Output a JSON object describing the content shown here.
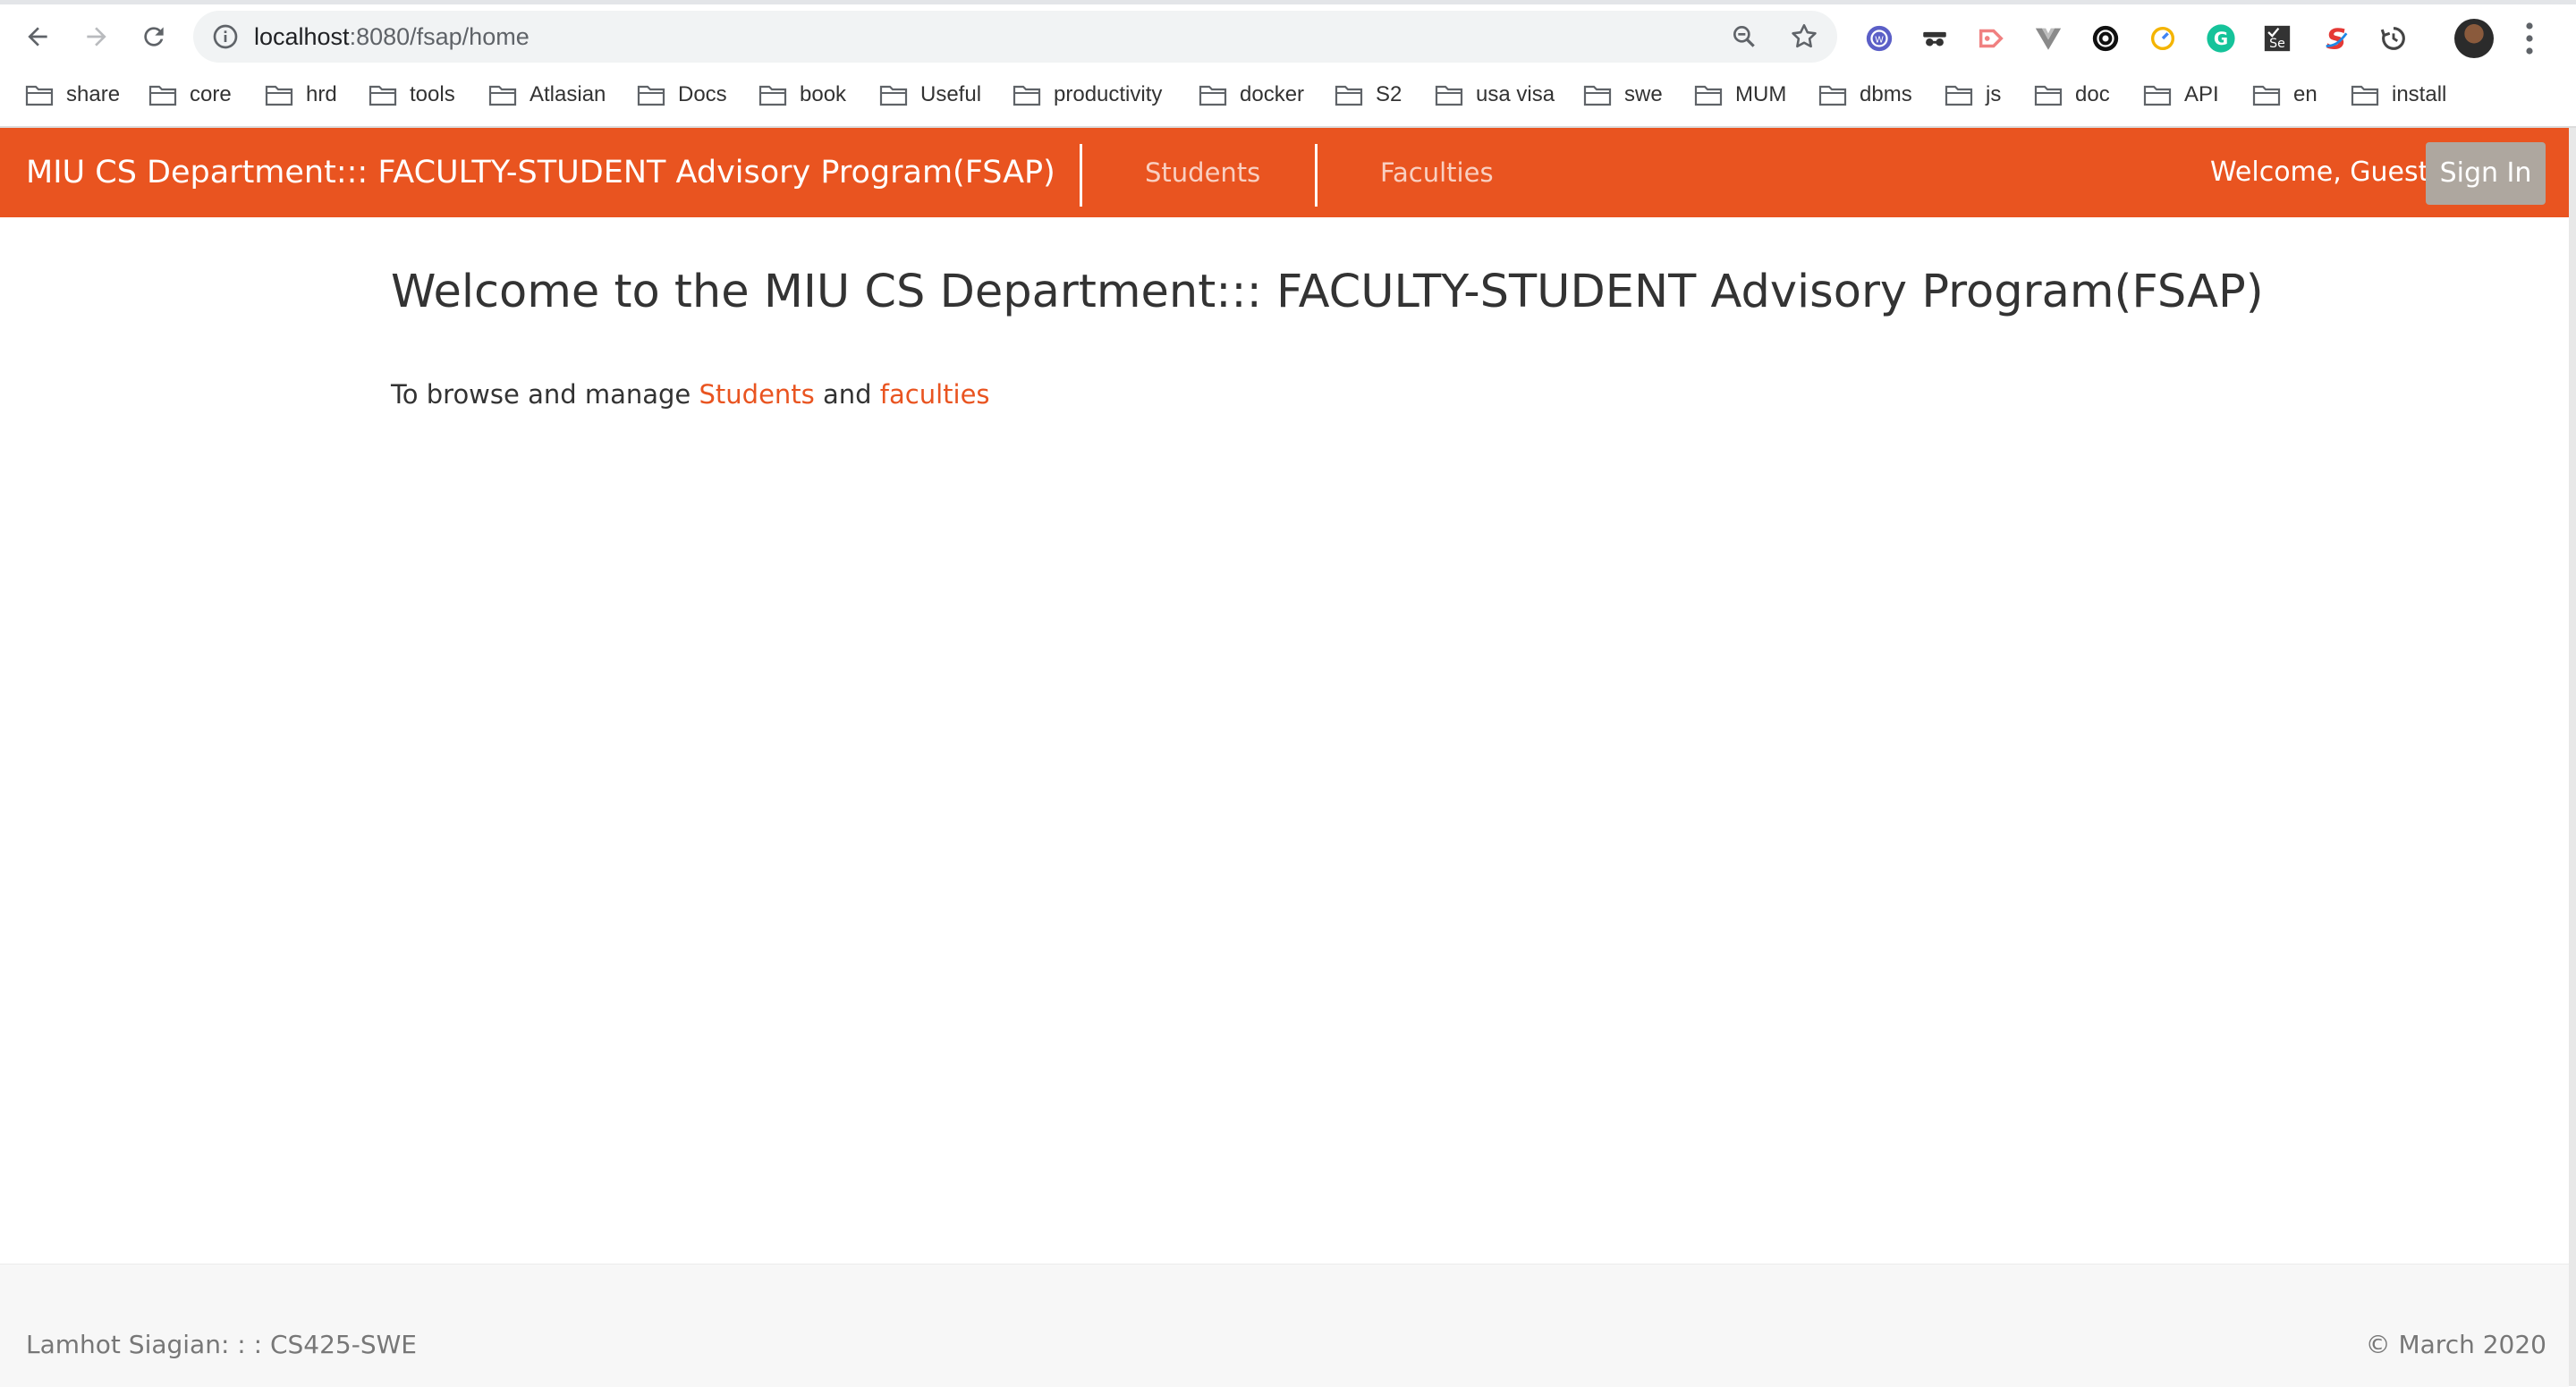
{
  "browser": {
    "url_host": "localhost",
    "url_path": ":8080/fsap/home",
    "extensions": [
      "vpn-globe-icon",
      "incognito-mask-icon",
      "screencast-icon",
      "vue-devtools-icon",
      "camera-lens-icon",
      "speed-dial-icon",
      "grammarly-icon",
      "selenium-icon",
      "stylus-icon",
      "sync-icon"
    ]
  },
  "bookmarks": [
    {
      "label": "share"
    },
    {
      "label": "core"
    },
    {
      "label": "hrd"
    },
    {
      "label": "tools"
    },
    {
      "label": "Atlasian"
    },
    {
      "label": "Docs"
    },
    {
      "label": "book"
    },
    {
      "label": "Useful"
    },
    {
      "label": "productivity"
    },
    {
      "label": "docker"
    },
    {
      "label": "S2"
    },
    {
      "label": "usa visa"
    },
    {
      "label": "swe"
    },
    {
      "label": "MUM"
    },
    {
      "label": "dbms"
    },
    {
      "label": "js"
    },
    {
      "label": "doc"
    },
    {
      "label": "API"
    },
    {
      "label": "en"
    },
    {
      "label": "install"
    }
  ],
  "navbar": {
    "brand": "MIU CS Department::: FACULTY-STUDENT Advisory Program(FSAP)",
    "links": [
      {
        "label": "Students"
      },
      {
        "label": "Faculties"
      }
    ],
    "welcome": "Welcome, Guest",
    "signin_label": "Sign In",
    "color": "#e95420"
  },
  "main": {
    "title": "Welcome to the MIU CS Department::: FACULTY-STUDENT Advisory Program(FSAP)",
    "intro_prefix": "To browse and manage ",
    "students_link": "Students",
    "intro_and": " and ",
    "faculties_link": "faculties"
  },
  "footer": {
    "left": "Lamhot Siagian: : : CS425-SWE",
    "right": "© March 2020"
  }
}
